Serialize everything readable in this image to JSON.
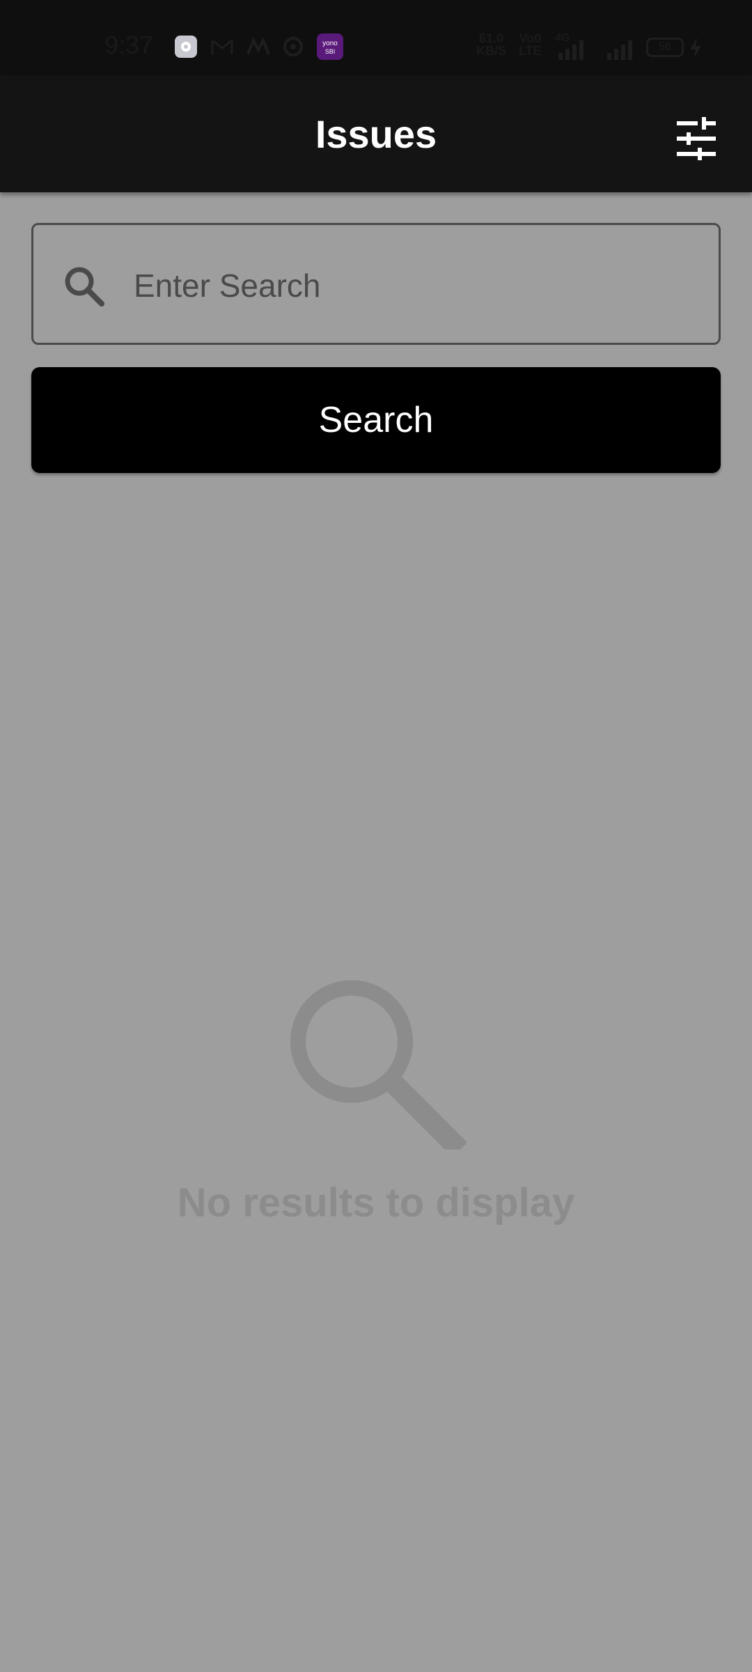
{
  "status_bar": {
    "time": "9:37",
    "network_speed": "61.0",
    "network_unit": "KB/S",
    "volte_top": "Vo0",
    "volte_bottom": "LTE",
    "signal_type": "4G",
    "battery": "56",
    "notification_icons": [
      "settings-icon",
      "gmail-icon",
      "m-app-icon",
      "sync-icon",
      "yono-sbi-icon"
    ]
  },
  "header": {
    "title": "Issues",
    "filter_icon": "tune-icon"
  },
  "search": {
    "placeholder": "Enter Search",
    "value": "",
    "button_label": "Search"
  },
  "empty_state": {
    "icon": "search-icon",
    "message": "No results to display"
  },
  "colors": {
    "background": "#9e9e9e",
    "appbar": "#141414",
    "button": "#000000",
    "empty_text": "#8c8c8c"
  }
}
